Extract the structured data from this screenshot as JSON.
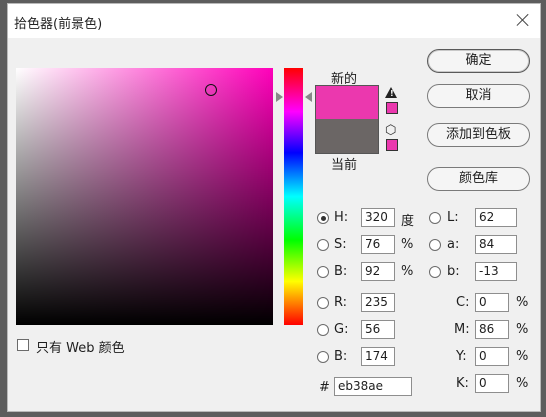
{
  "dialog": {
    "title": "拾色器(前景色)"
  },
  "preview": {
    "new_label": "新的",
    "current_label": "当前",
    "new_color": "#eb38ae",
    "current_color": "#6b6665"
  },
  "buttons": {
    "ok": "确定",
    "cancel": "取消",
    "add_to_swatches": "添加到色板",
    "color_libraries": "颜色库"
  },
  "fields": {
    "H": {
      "label": "H:",
      "value": "320",
      "unit": "度",
      "selected": true
    },
    "S": {
      "label": "S:",
      "value": "76",
      "unit": "%"
    },
    "Bv": {
      "label": "B:",
      "value": "92",
      "unit": "%"
    },
    "R": {
      "label": "R:",
      "value": "235"
    },
    "G": {
      "label": "G:",
      "value": "56"
    },
    "Bb": {
      "label": "B:",
      "value": "174"
    },
    "L": {
      "label": "L:",
      "value": "62"
    },
    "a": {
      "label": "a:",
      "value": "84"
    },
    "b": {
      "label": "b:",
      "value": "-13"
    },
    "C": {
      "label": "C:",
      "value": "0",
      "unit": "%"
    },
    "M": {
      "label": "M:",
      "value": "86",
      "unit": "%"
    },
    "Y": {
      "label": "Y:",
      "value": "0",
      "unit": "%"
    },
    "K": {
      "label": "K:",
      "value": "0",
      "unit": "%"
    },
    "hex": {
      "label": "#",
      "value": "eb38ae"
    }
  },
  "web_only": {
    "label": "只有 Web 颜色",
    "checked": false
  },
  "icons": {
    "close": "close-icon",
    "warning": "warning-icon",
    "websafe": "cube-icon"
  }
}
